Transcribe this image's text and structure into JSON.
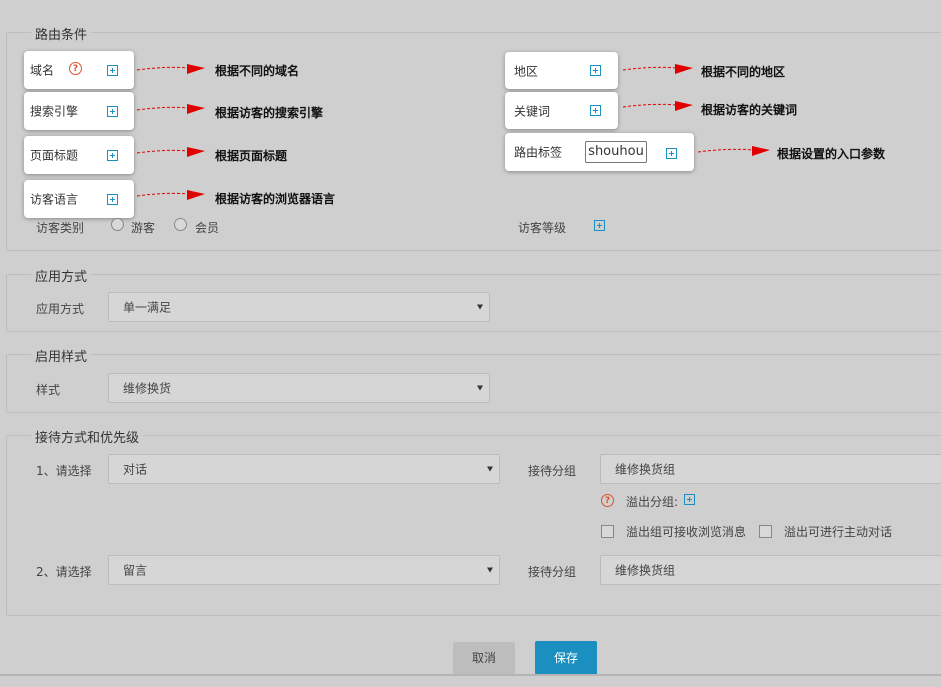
{
  "routing": {
    "legend": "路由条件",
    "domain": {
      "label": "域名",
      "help": "?",
      "note": "根据不同的域名"
    },
    "search_engine": {
      "label": "搜索引擎",
      "note": "根据访客的搜索引擎"
    },
    "page_title": {
      "label": "页面标题",
      "note": "根据页面标题"
    },
    "visitor_lang": {
      "label": "访客语言",
      "note": "根据访客的浏览器语言"
    },
    "region": {
      "label": "地区",
      "note": "根据不同的地区"
    },
    "keyword": {
      "label": "关键词",
      "note": "根据访客的关键词"
    },
    "route_tag": {
      "label": "路由标签",
      "value": "shouhou",
      "note": "根据设置的入口参数"
    },
    "visitor_type": {
      "label": "访客类别",
      "options": [
        "游客",
        "会员"
      ]
    },
    "visitor_level": {
      "label": "访客等级"
    }
  },
  "apply": {
    "legend": "应用方式",
    "label": "应用方式",
    "value": "单一满足"
  },
  "style": {
    "legend": "启用样式",
    "label": "样式",
    "value": "维修换货"
  },
  "reception": {
    "legend": "接待方式和优先级",
    "rows": [
      {
        "label": "1、请选择",
        "value": "对话",
        "group_label": "接待分组",
        "group_value": "维修换货组"
      },
      {
        "label": "2、请选择",
        "value": "留言",
        "group_label": "接待分组",
        "group_value": "维修换货组"
      }
    ],
    "overflow_help": "?",
    "overflow_label": "溢出分组:",
    "overflow_check1": "溢出组可接收浏览消息",
    "overflow_check2": "溢出可进行主动对话"
  },
  "buttons": {
    "cancel": "取消",
    "save": "保存"
  },
  "colors": {
    "accent": "#1a8fc1",
    "arrow": "#e00000",
    "save_bg": "#1b8fc0",
    "cancel_bg": "#bdbdbd"
  }
}
